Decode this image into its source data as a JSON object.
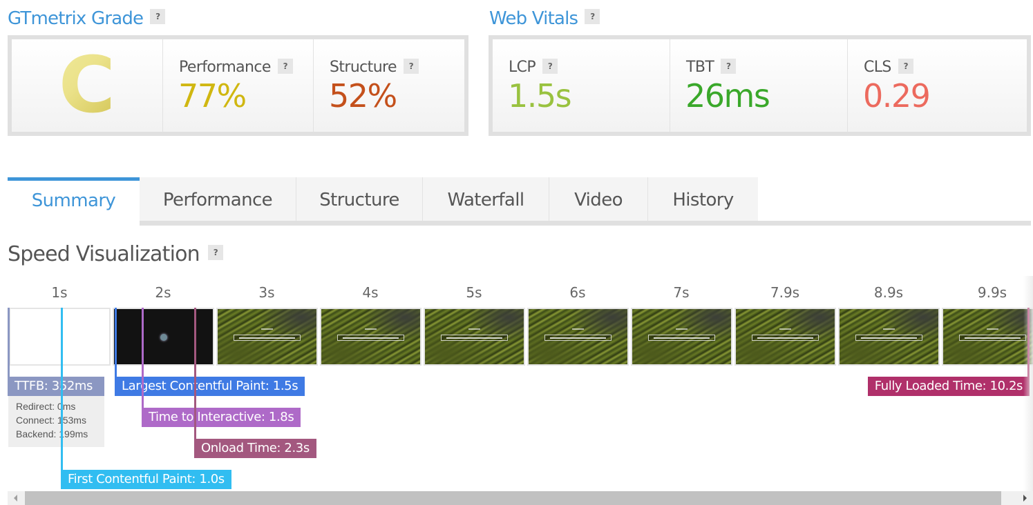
{
  "grade": {
    "title": "GTmetrix Grade",
    "help": "?",
    "letter": "C",
    "metrics": [
      {
        "label": "Performance",
        "value": "77%",
        "color": "#d0b711"
      },
      {
        "label": "Structure",
        "value": "52%",
        "color": "#c4501b"
      }
    ]
  },
  "vitals": {
    "title": "Web Vitals",
    "help": "?",
    "metrics": [
      {
        "label": "LCP",
        "value": "1.5s",
        "color": "#99c23f"
      },
      {
        "label": "TBT",
        "value": "26ms",
        "color": "#3aa82a"
      },
      {
        "label": "CLS",
        "value": "0.29",
        "color": "#ec6a5e"
      }
    ]
  },
  "tabs": [
    {
      "label": "Summary",
      "active": true
    },
    {
      "label": "Performance",
      "active": false
    },
    {
      "label": "Structure",
      "active": false
    },
    {
      "label": "Waterfall",
      "active": false
    },
    {
      "label": "Video",
      "active": false
    },
    {
      "label": "History",
      "active": false
    }
  ],
  "speed": {
    "title": "Speed Visualization",
    "help": "?",
    "frames": [
      {
        "time": "1s",
        "thumb": "blank"
      },
      {
        "time": "2s",
        "thumb": "dark"
      },
      {
        "time": "3s",
        "thumb": "green"
      },
      {
        "time": "4s",
        "thumb": "green"
      },
      {
        "time": "5s",
        "thumb": "green"
      },
      {
        "time": "6s",
        "thumb": "green"
      },
      {
        "time": "7s",
        "thumb": "green"
      },
      {
        "time": "7.9s",
        "thumb": "green"
      },
      {
        "time": "8.9s",
        "thumb": "green"
      },
      {
        "time": "9.9s",
        "thumb": "green"
      }
    ],
    "markers": {
      "ttfb": {
        "label": "TTFB: 352ms",
        "color": "#8b97c2"
      },
      "fcp": {
        "label": "First Contentful Paint: 1.0s",
        "color": "#31bdf1"
      },
      "lcp": {
        "label": "Largest Contentful Paint: 1.5s",
        "color": "#3f7ae4"
      },
      "tti": {
        "label": "Time to Interactive: 1.8s",
        "color": "#ae6ac8"
      },
      "onload": {
        "label": "Onload Time: 2.3s",
        "color": "#a3587f"
      },
      "fully": {
        "label": "Fully Loaded Time: 10.2s",
        "color": "#b0306a"
      }
    },
    "ttfb_breakdown": [
      "Redirect: 0ms",
      "Connect: 153ms",
      "Backend: 199ms"
    ]
  }
}
